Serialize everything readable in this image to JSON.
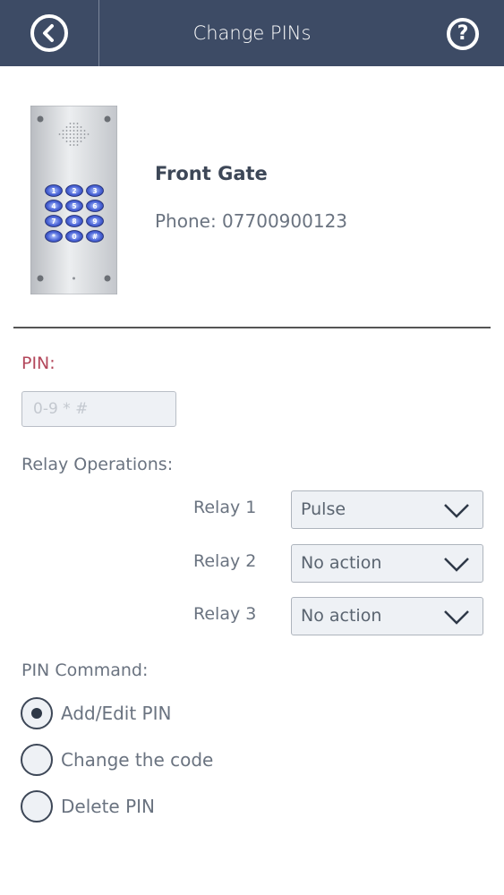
{
  "header": {
    "title": "Change PINs",
    "back_icon": "chevron-left-circle-icon",
    "help_icon": "question-circle-icon",
    "help_glyph": "?"
  },
  "device": {
    "name": "Front Gate",
    "phone": "Phone: 07700900123",
    "image": "intercom-keypad-panel",
    "keypad_keys": [
      "1",
      "2",
      "3",
      "4",
      "5",
      "6",
      "7",
      "8",
      "9",
      "*",
      "0",
      "#"
    ]
  },
  "pin": {
    "label": "PIN:",
    "value": "",
    "placeholder": "0-9 * #"
  },
  "relays": {
    "label": "Relay Operations:",
    "items": [
      {
        "label": "Relay 1",
        "value": "Pulse"
      },
      {
        "label": "Relay 2",
        "value": "No action"
      },
      {
        "label": "Relay 3",
        "value": "No action"
      }
    ]
  },
  "command": {
    "label": "PIN Command:",
    "options": [
      {
        "label": "Add/Edit PIN",
        "selected": true
      },
      {
        "label": "Change the code",
        "selected": false
      },
      {
        "label": "Delete PIN",
        "selected": false
      }
    ]
  },
  "colors": {
    "header_bg": "#3d4b65",
    "pin_label": "#b3475b",
    "field_bg": "#eef1f5"
  }
}
